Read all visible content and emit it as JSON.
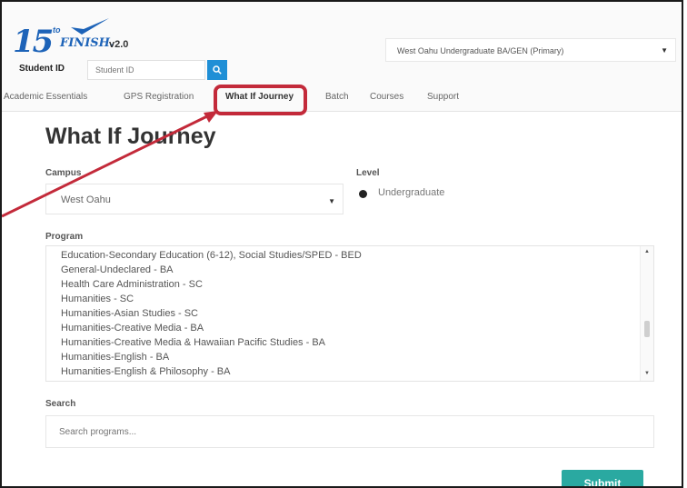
{
  "header": {
    "logo": {
      "number": "15",
      "to": "to",
      "finish": "FINISH.",
      "version": "v2.0"
    },
    "student_id_label": "Student ID",
    "student_id_placeholder": "Student ID",
    "program_select_value": "West Oahu Undergraduate BA/GEN (Primary)"
  },
  "tabs": [
    {
      "label": "Academic Essentials"
    },
    {
      "label": "GPS Registration"
    },
    {
      "label": "What If Journey",
      "active": true
    },
    {
      "label": "Batch"
    },
    {
      "label": "Courses"
    },
    {
      "label": "Support"
    }
  ],
  "main": {
    "title": "What If Journey",
    "campus_label": "Campus",
    "campus_value": "West Oahu",
    "level_label": "Level",
    "level_option": "Undergraduate",
    "program_label": "Program",
    "programs": [
      "Education-Secondary Education (6-12), Social Studies/SPED - BED",
      "General-Undeclared - BA",
      "Health Care Administration - SC",
      "Humanities - SC",
      "Humanities-Asian Studies - SC",
      "Humanities-Creative Media - BA",
      "Humanities-Creative Media & Hawaiian Pacific Studies - BA",
      "Humanities-English - BA",
      "Humanities-English & Philosophy - BA"
    ],
    "search_label": "Search",
    "search_placeholder": "Search programs...",
    "submit_label": "Submit"
  },
  "colors": {
    "brand_blue": "#1d63b8",
    "search_button": "#1f8fd6",
    "submit": "#2aa9a1",
    "annotation": "#c32a3a"
  },
  "icons": {
    "search": "magnifier-icon",
    "dropdown": "caret-down-icon",
    "logo_mark": "checkmark-swoosh-icon"
  }
}
